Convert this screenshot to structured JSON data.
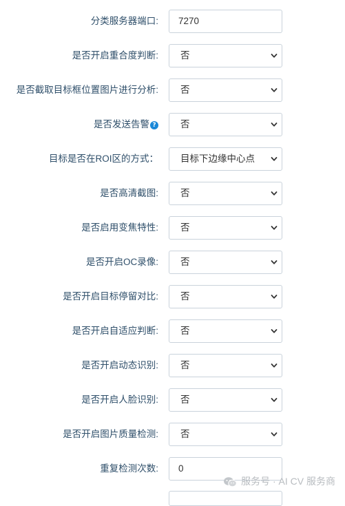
{
  "form": {
    "rows": [
      {
        "label": "分类服务器端口:",
        "kind": "input",
        "value": "7270"
      },
      {
        "label": "是否开启重合度判断:",
        "kind": "select",
        "value": "否"
      },
      {
        "label": "是否截取目标框位置图片进行分析:",
        "kind": "select",
        "value": "否"
      },
      {
        "label": "是否发送告警",
        "kind": "select",
        "value": "否",
        "help_icon": "question-circle-icon"
      },
      {
        "label": "目标是否在ROI区的方式：",
        "kind": "select",
        "value": "目标下边缘中心点"
      },
      {
        "label": "是否高清截图:",
        "kind": "select",
        "value": "否"
      },
      {
        "label": "是否启用变焦特性:",
        "kind": "select",
        "value": "否"
      },
      {
        "label": "是否开启OC录像:",
        "kind": "select",
        "value": "否"
      },
      {
        "label": "是否开启目标停留对比:",
        "kind": "select",
        "value": "否"
      },
      {
        "label": "是否开启自适应判断:",
        "kind": "select",
        "value": "否"
      },
      {
        "label": "是否开启动态识别:",
        "kind": "select",
        "value": "否"
      },
      {
        "label": "是否开启人脸识别:",
        "kind": "select",
        "value": "否"
      },
      {
        "label": "是否开启图片质量检测:",
        "kind": "select",
        "value": "否"
      },
      {
        "label": "重复检测次数:",
        "kind": "input",
        "value": "0"
      }
    ],
    "help_icon_glyph": "?"
  },
  "watermark": {
    "text": "服务号 · AI CV 服务商",
    "icon": "wechat-icon"
  },
  "colors": {
    "label": "#2f4f6a",
    "border": "#c9d2db",
    "help_icon": "#1a88d8",
    "watermark": "#b8bcc0"
  }
}
